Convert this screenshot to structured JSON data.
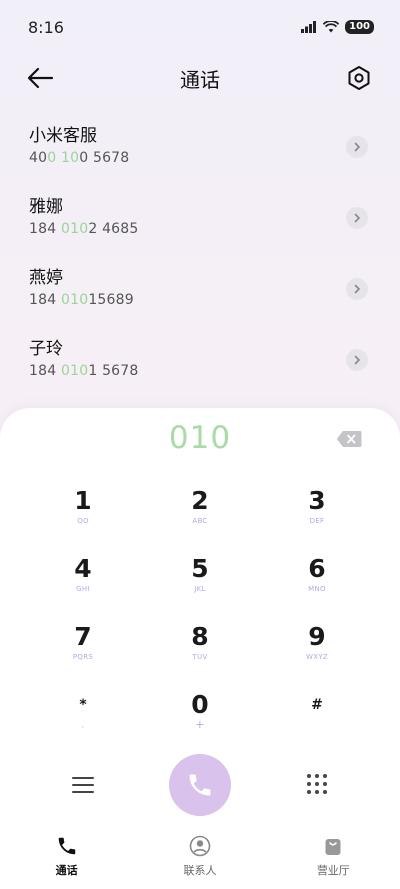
{
  "status_bar": {
    "time": "8:16",
    "battery": "100"
  },
  "header": {
    "title": "通话"
  },
  "contacts": [
    {
      "name": "小米客服",
      "number_parts": [
        "40",
        "0",
        " ",
        "10",
        "0 5678"
      ]
    },
    {
      "name": "雅娜",
      "number_parts": [
        "184 ",
        "010",
        "2 4685"
      ]
    },
    {
      "name": "燕婷",
      "number_parts": [
        "184 ",
        "010",
        "15689"
      ]
    },
    {
      "name": "子玲",
      "number_parts": [
        "184 ",
        "010",
        "1 5678"
      ]
    }
  ],
  "dialer": {
    "display": "010",
    "keys": [
      {
        "digit": "1",
        "letters": "QO"
      },
      {
        "digit": "2",
        "letters": "ABC"
      },
      {
        "digit": "3",
        "letters": "DEF"
      },
      {
        "digit": "4",
        "letters": "GHI"
      },
      {
        "digit": "5",
        "letters": "JKL"
      },
      {
        "digit": "6",
        "letters": "MNO"
      },
      {
        "digit": "7",
        "letters": "PQRS"
      },
      {
        "digit": "8",
        "letters": "TUV"
      },
      {
        "digit": "9",
        "letters": "WXYZ"
      },
      {
        "digit": "*",
        "letters": ","
      },
      {
        "digit": "0",
        "letters": "+"
      },
      {
        "digit": "#",
        "letters": ""
      }
    ]
  },
  "tabs": [
    {
      "label": "通话",
      "icon": "phone-icon",
      "active": true
    },
    {
      "label": "联系人",
      "icon": "person-icon",
      "active": false
    },
    {
      "label": "营业厅",
      "icon": "bag-icon",
      "active": false
    }
  ],
  "colors": {
    "accent_green": "#9bd49a",
    "call_button": "#d9c3ec",
    "letters": "#b4a8e6"
  }
}
